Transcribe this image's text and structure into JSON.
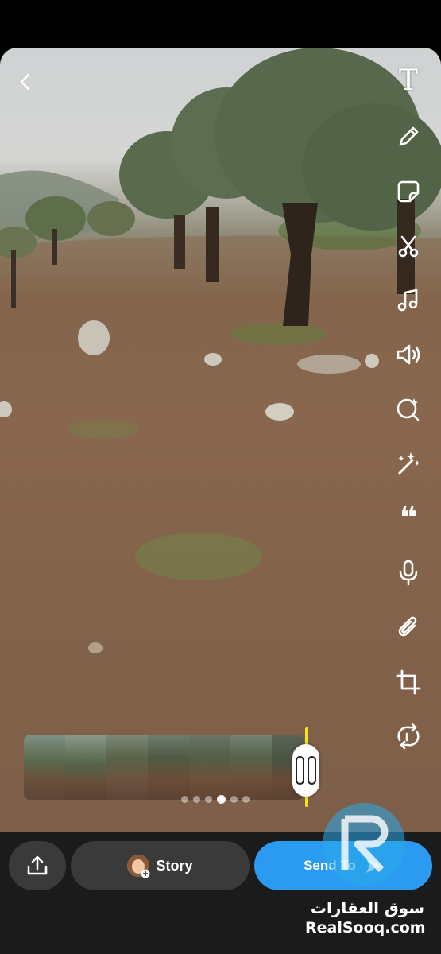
{
  "editor": {
    "toolbar": [
      {
        "name": "text-tool",
        "icon": "text-icon"
      },
      {
        "name": "draw-tool",
        "icon": "pencil-icon"
      },
      {
        "name": "sticker-tool",
        "icon": "sticker-icon"
      },
      {
        "name": "scissors-tool",
        "icon": "scissors-icon"
      },
      {
        "name": "music-tool",
        "icon": "music-note-icon"
      },
      {
        "name": "sound-tool",
        "icon": "speaker-icon"
      },
      {
        "name": "lens-tool",
        "icon": "lens-sparkle-icon"
      },
      {
        "name": "effects-tool",
        "icon": "magic-wand-icon"
      },
      {
        "name": "quote-tool",
        "icon": "quote-icon"
      },
      {
        "name": "voiceover-tool",
        "icon": "microphone-icon"
      },
      {
        "name": "attach-tool",
        "icon": "paperclip-icon"
      },
      {
        "name": "crop-tool",
        "icon": "crop-icon"
      },
      {
        "name": "loop-tool",
        "icon": "loop-icon"
      }
    ],
    "text_tool_glyph": "T",
    "quote_glyph": "❝"
  },
  "timeline": {
    "dots_count": 6,
    "active_dot_index": 3,
    "trim_color": "#f1e41c"
  },
  "bottom_bar": {
    "story_label": "Story",
    "send_label": "Send To",
    "send_color": "#2a9bf0"
  },
  "watermark": {
    "arabic_text": "سوق العقارات",
    "site_text": "RealSooq.com"
  }
}
